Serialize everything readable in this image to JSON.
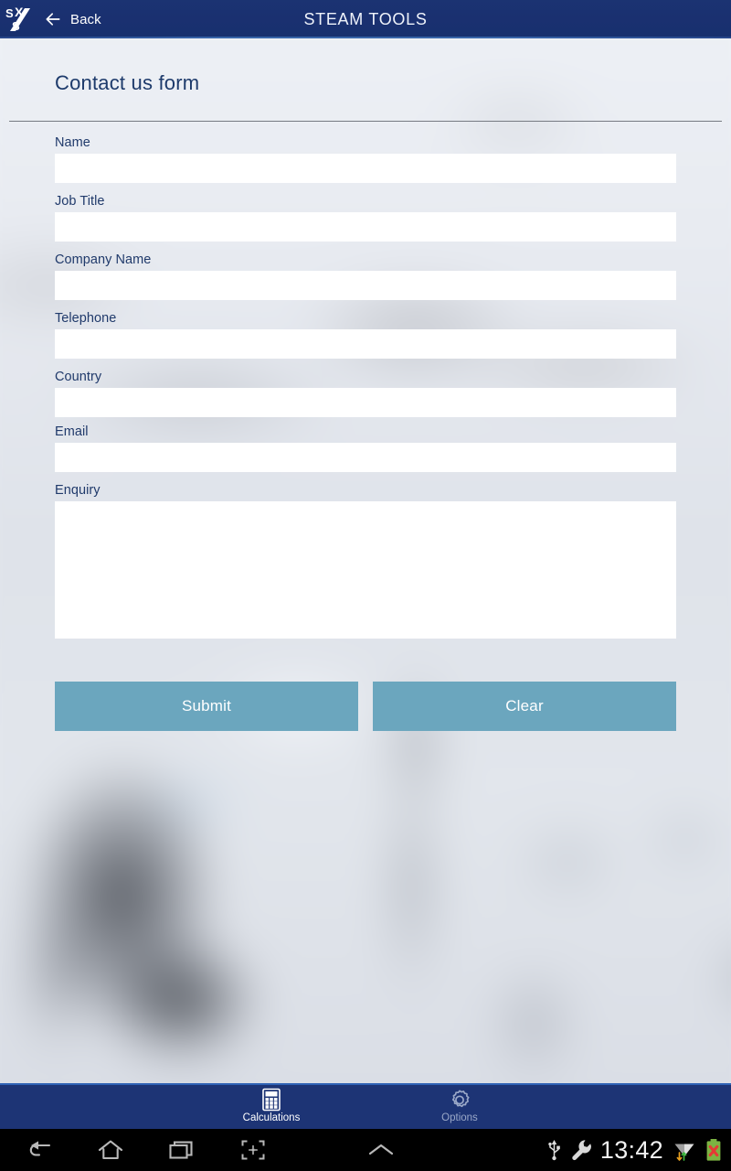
{
  "appbar": {
    "logo_alt": "spirax-sarco-logo",
    "back_label": "Back",
    "title": "STEAM TOOLS"
  },
  "page": {
    "title": "Contact us form"
  },
  "form": {
    "fields": [
      {
        "label": "Name",
        "value": "",
        "placeholder": "",
        "type": "text"
      },
      {
        "label": "Job Title",
        "value": "",
        "placeholder": "",
        "type": "text"
      },
      {
        "label": "Company Name",
        "value": "",
        "placeholder": "",
        "type": "text"
      },
      {
        "label": "Telephone",
        "value": "",
        "placeholder": "",
        "type": "text"
      },
      {
        "label": "Country",
        "value": "",
        "placeholder": "",
        "type": "text"
      },
      {
        "label": "Email",
        "value": "",
        "placeholder": "",
        "type": "text"
      },
      {
        "label": "Enquiry",
        "value": "",
        "placeholder": "",
        "type": "textarea"
      }
    ],
    "submit_label": "Submit",
    "clear_label": "Clear"
  },
  "tabbar": {
    "tabs": [
      {
        "label": "Calculations",
        "icon": "calculator-icon",
        "active": true
      },
      {
        "label": "Options",
        "icon": "gear-icon",
        "active": false
      }
    ]
  },
  "system_bar": {
    "nav_keys": [
      "back-icon",
      "home-icon",
      "recents-icon",
      "screenshot-icon",
      "expand-up-icon"
    ],
    "status_icons": [
      "usb-icon",
      "wrench-icon"
    ],
    "clock": "13:42",
    "right_icons": [
      "wifi-transfer-icon",
      "battery-error-icon"
    ]
  },
  "colors": {
    "appbar_blue": "#1a3070",
    "tabbar_blue": "#1d3475",
    "button_blue": "#6ba6be",
    "label_navy": "#203a6b",
    "title_navy": "#1d3a6b"
  }
}
